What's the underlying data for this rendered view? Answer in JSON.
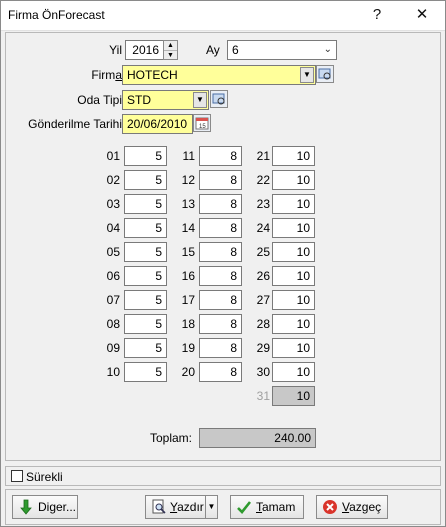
{
  "window": {
    "title": "Firma ÖnForecast",
    "help_label": "?",
    "close_label": "✕"
  },
  "form": {
    "yil_label": "Yil",
    "yil_value": "2016",
    "ay_label": "Ay",
    "ay_value": "6",
    "firma_label_pre": "Firm",
    "firma_label_ul": "a",
    "firma_value": "HOTECH",
    "oda_tipi_label": "Oda Tipi",
    "oda_tipi_value": "STD",
    "gonderilme_label": "Gönderilme Tarihi",
    "gonderilme_value": "20/06/2010"
  },
  "days": {
    "col1": [
      {
        "day": "01",
        "value": "5"
      },
      {
        "day": "02",
        "value": "5"
      },
      {
        "day": "03",
        "value": "5"
      },
      {
        "day": "04",
        "value": "5"
      },
      {
        "day": "05",
        "value": "5"
      },
      {
        "day": "06",
        "value": "5"
      },
      {
        "day": "07",
        "value": "5"
      },
      {
        "day": "08",
        "value": "5"
      },
      {
        "day": "09",
        "value": "5"
      },
      {
        "day": "10",
        "value": "5"
      }
    ],
    "col2": [
      {
        "day": "11",
        "value": "8"
      },
      {
        "day": "12",
        "value": "8"
      },
      {
        "day": "13",
        "value": "8"
      },
      {
        "day": "14",
        "value": "8"
      },
      {
        "day": "15",
        "value": "8"
      },
      {
        "day": "16",
        "value": "8"
      },
      {
        "day": "17",
        "value": "8"
      },
      {
        "day": "18",
        "value": "8"
      },
      {
        "day": "19",
        "value": "8"
      },
      {
        "day": "20",
        "value": "8"
      }
    ],
    "col3": [
      {
        "day": "21",
        "value": "10"
      },
      {
        "day": "22",
        "value": "10"
      },
      {
        "day": "23",
        "value": "10"
      },
      {
        "day": "24",
        "value": "10"
      },
      {
        "day": "25",
        "value": "10"
      },
      {
        "day": "26",
        "value": "10"
      },
      {
        "day": "27",
        "value": "10"
      },
      {
        "day": "28",
        "value": "10"
      },
      {
        "day": "29",
        "value": "10"
      },
      {
        "day": "30",
        "value": "10"
      },
      {
        "day": "31",
        "value": "10",
        "disabled": true
      }
    ]
  },
  "total": {
    "label": "Toplam:",
    "value": "240.00"
  },
  "surekli": {
    "label": "Sürekli",
    "checked": false
  },
  "buttons": {
    "diger": "Diger...",
    "yazdir_ul": "Y",
    "yazdir_rest": "azdır",
    "tamam_ul": "T",
    "tamam_rest": "amam",
    "vazgec_ul": "V",
    "vazgec_rest": "azgeç"
  },
  "colors": {
    "required_field": "#ffff9a",
    "disabled_field": "#c8c8c8",
    "disabled_label": "#a0a0a0"
  }
}
